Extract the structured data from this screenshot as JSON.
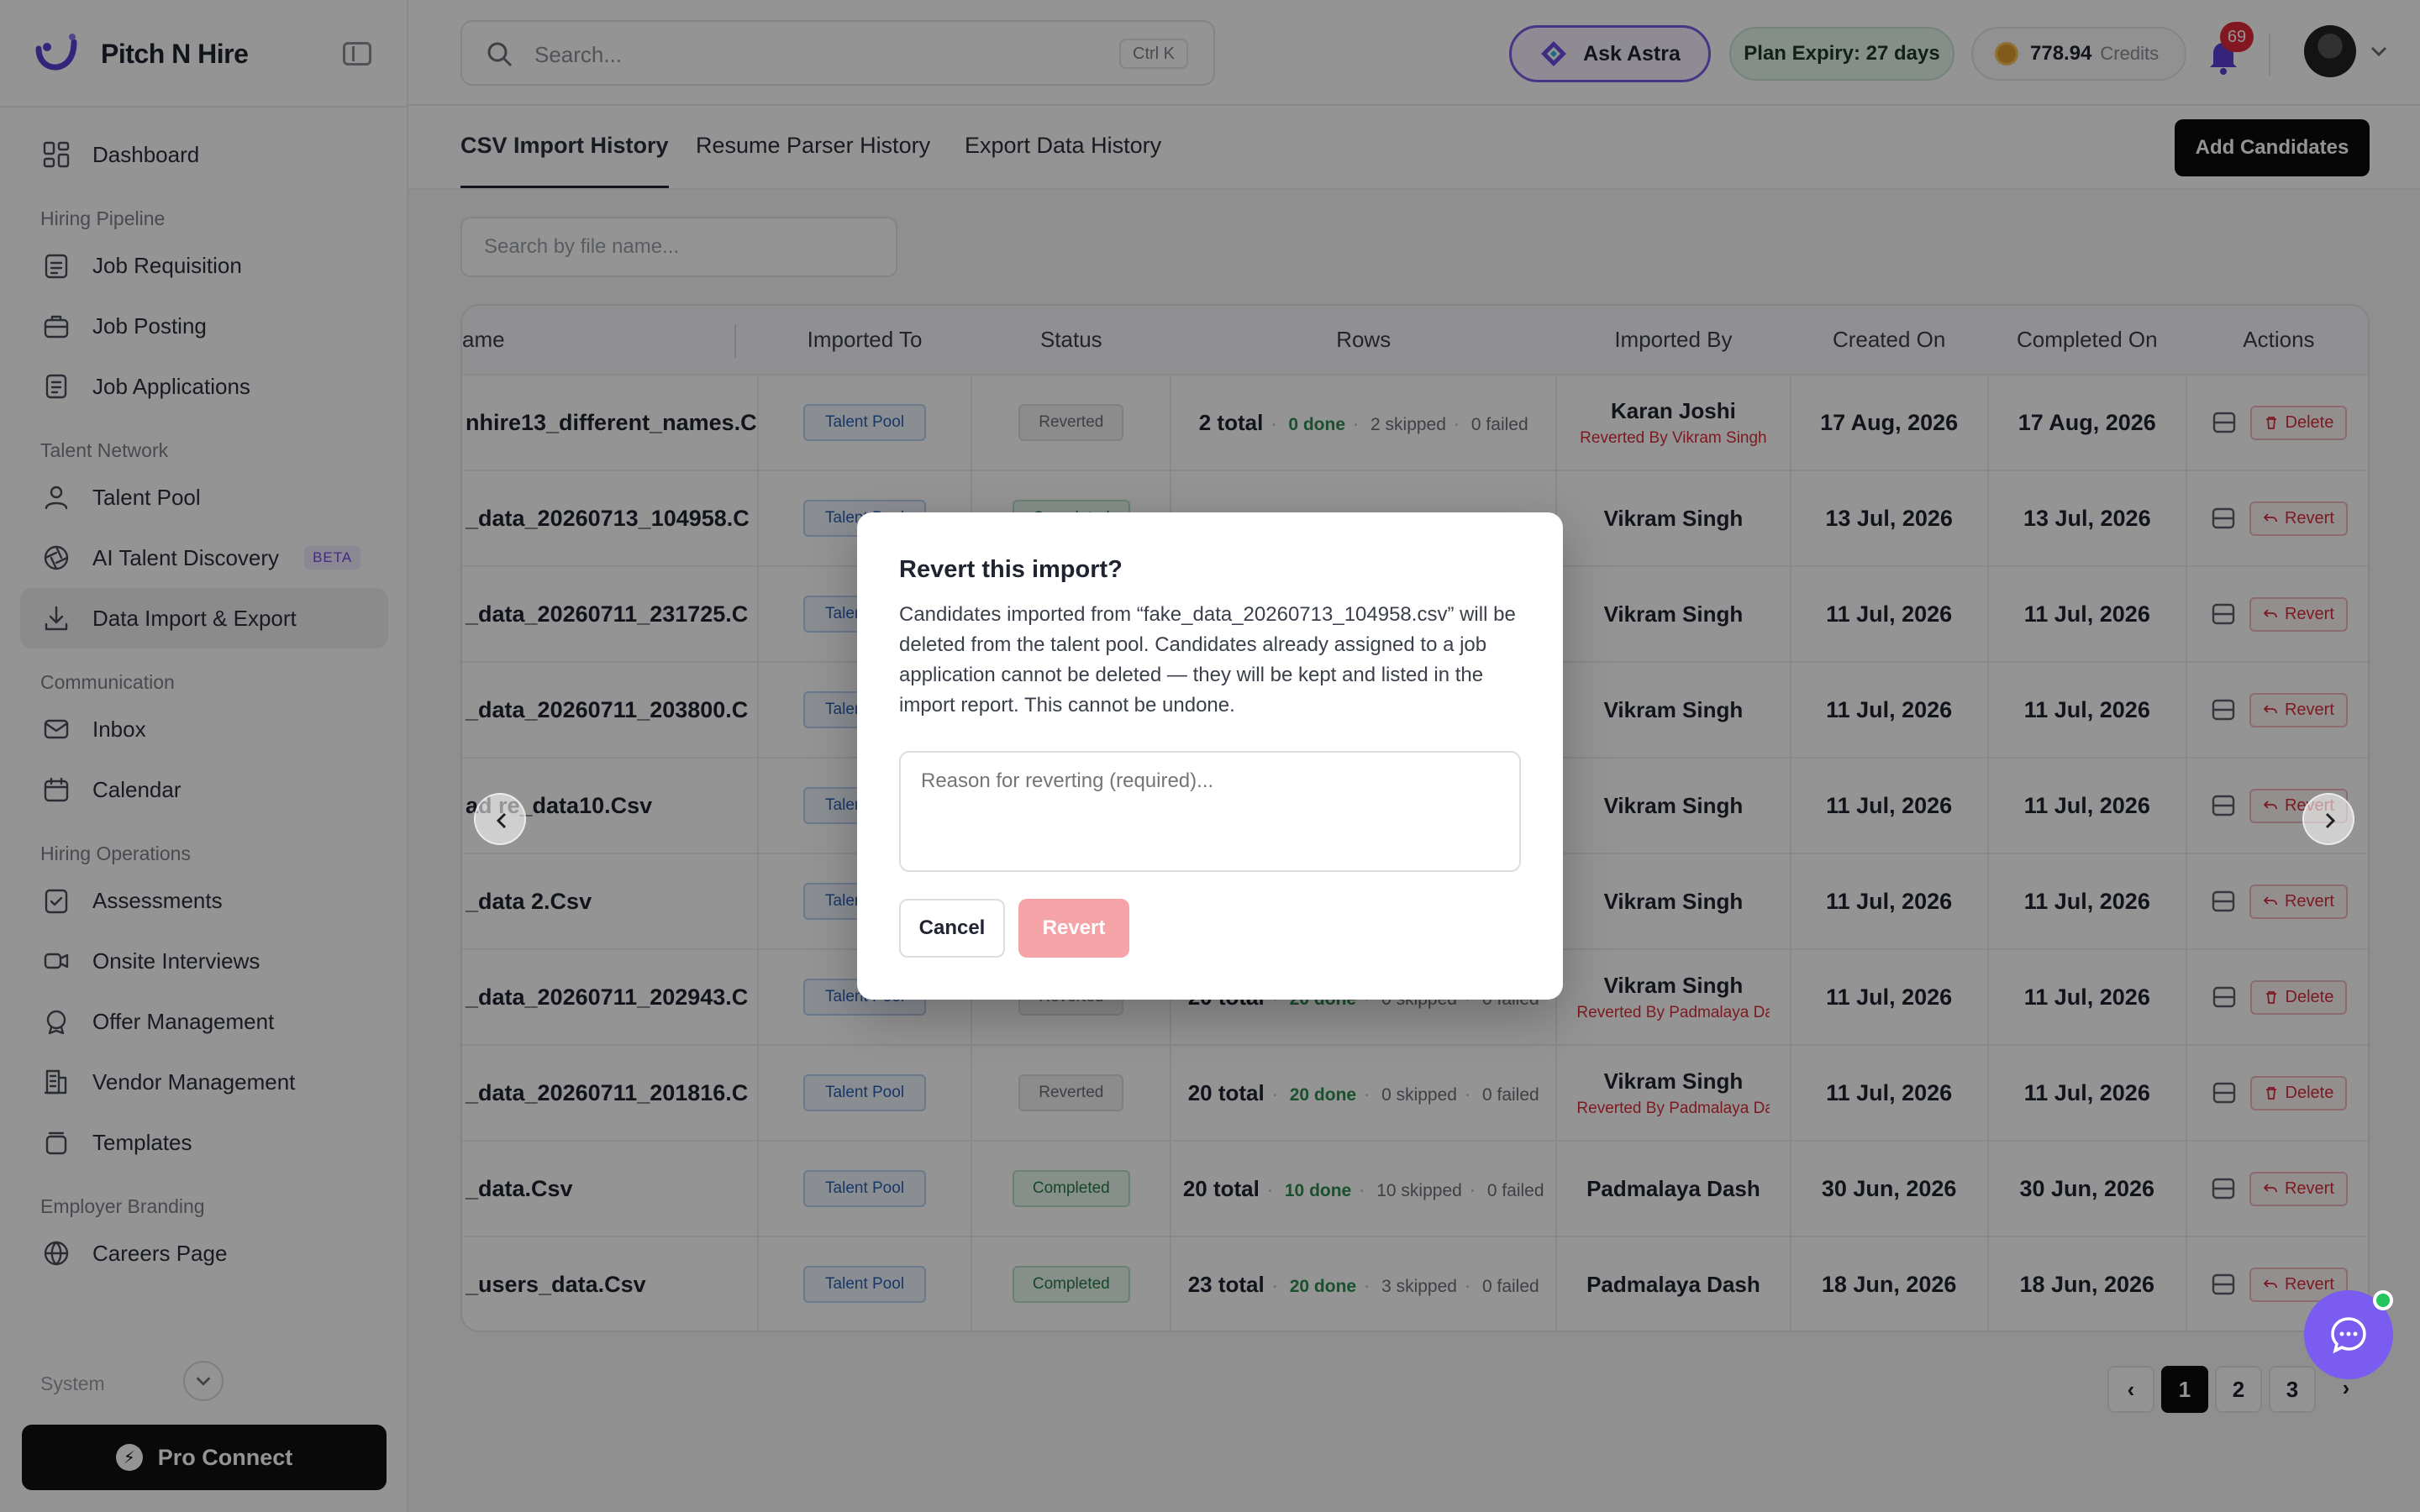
{
  "app": {
    "name": "Pitch N Hire"
  },
  "sidebar": {
    "sections": [
      {
        "label": "",
        "items": [
          {
            "label": "Dashboard",
            "icon": "grid-icon"
          }
        ]
      },
      {
        "label": "Hiring Pipeline",
        "items": [
          {
            "label": "Job Requisition",
            "icon": "clipboard-icon"
          },
          {
            "label": "Job Posting",
            "icon": "briefcase-icon"
          },
          {
            "label": "Job Applications",
            "icon": "document-icon"
          }
        ]
      },
      {
        "label": "Talent Network",
        "items": [
          {
            "label": "Talent Pool",
            "icon": "users-icon"
          },
          {
            "label": "AI Talent Discovery",
            "icon": "aperture-icon",
            "badge": "BETA"
          },
          {
            "label": "Data Import & Export",
            "icon": "download-icon",
            "active": true
          }
        ]
      },
      {
        "label": "Communication",
        "items": [
          {
            "label": "Inbox",
            "icon": "mail-icon"
          },
          {
            "label": "Calendar",
            "icon": "calendar-icon"
          }
        ]
      },
      {
        "label": "Hiring Operations",
        "items": [
          {
            "label": "Assessments",
            "icon": "clipboard-check-icon"
          },
          {
            "label": "Onsite Interviews",
            "icon": "video-icon"
          },
          {
            "label": "Offer Management",
            "icon": "badge-icon"
          },
          {
            "label": "Vendor Management",
            "icon": "building-icon"
          },
          {
            "label": "Templates",
            "icon": "stack-icon"
          }
        ]
      },
      {
        "label": "Employer Branding",
        "items": [
          {
            "label": "Careers Page",
            "icon": "globe-icon"
          }
        ]
      }
    ],
    "system_label": "System",
    "pro_connect": "Pro Connect"
  },
  "topbar": {
    "search_placeholder": "Search...",
    "search_shortcut": "Ctrl K",
    "ask_astra": "Ask Astra",
    "plan_expiry": "Plan Expiry: 27 days",
    "credits_value": "778.94",
    "credits_label": "Credits",
    "notifications": "69"
  },
  "tabs": [
    {
      "label": "CSV Import History",
      "active": true
    },
    {
      "label": "Resume Parser History"
    },
    {
      "label": "Export Data History"
    }
  ],
  "add_candidates": "Add Candidates",
  "file_search_placeholder": "Search by file name...",
  "table": {
    "columns": [
      "ame",
      "Imported To",
      "Status",
      "Rows",
      "Imported By",
      "Created On",
      "Completed On",
      "Actions"
    ],
    "rows": [
      {
        "file": "nhire13_different_names.C",
        "to": "Talent Pool",
        "status": "Reverted",
        "total": "2 total",
        "done": "0 done",
        "skipped": "2 skipped",
        "failed": "0 failed",
        "by": "Karan Joshi",
        "reverted_by": "Reverted By Vikram Singh",
        "created": "17 Aug, 2026",
        "completed": "17 Aug, 2026",
        "action": "Delete"
      },
      {
        "file": "_data_20260713_104958.C",
        "to": "Talent Pool",
        "status": "Completed",
        "total": "",
        "done": "",
        "skipped": "",
        "failed": "",
        "by": "Vikram Singh",
        "reverted_by": "",
        "created": "13 Jul, 2026",
        "completed": "13 Jul, 2026",
        "action": "Revert"
      },
      {
        "file": "_data_20260711_231725.C",
        "to": "Talent Pool",
        "status": "",
        "total": "",
        "done": "",
        "skipped": "",
        "failed": "",
        "by": "Vikram Singh",
        "reverted_by": "",
        "created": "11 Jul, 2026",
        "completed": "11 Jul, 2026",
        "action": "Revert"
      },
      {
        "file": "_data_20260711_203800.C",
        "to": "Talent Pool",
        "status": "",
        "total": "",
        "done": "",
        "skipped": "",
        "failed": "",
        "by": "Vikram Singh",
        "reverted_by": "",
        "created": "11 Jul, 2026",
        "completed": "11 Jul, 2026",
        "action": "Revert"
      },
      {
        "file": "ad  re_data10.Csv",
        "to": "Talent Pool",
        "status": "",
        "total": "",
        "done": "",
        "skipped": "",
        "failed": "",
        "by": "Vikram Singh",
        "reverted_by": "",
        "created": "11 Jul, 2026",
        "completed": "11 Jul, 2026",
        "action": "Revert"
      },
      {
        "file": "_data 2.Csv",
        "to": "Talent Pool",
        "status": "",
        "total": "",
        "done": "",
        "skipped": "",
        "failed": "",
        "by": "Vikram Singh",
        "reverted_by": "",
        "created": "11 Jul, 2026",
        "completed": "11 Jul, 2026",
        "action": "Revert"
      },
      {
        "file": "_data_20260711_202943.C",
        "to": "Talent Pool",
        "status": "Reverted",
        "total": "20 total",
        "done": "20 done",
        "skipped": "0 skipped",
        "failed": "0 failed",
        "by": "Vikram Singh",
        "reverted_by": "Reverted By Padmalaya Dash",
        "created": "11 Jul, 2026",
        "completed": "11 Jul, 2026",
        "action": "Delete"
      },
      {
        "file": "_data_20260711_201816.C",
        "to": "Talent Pool",
        "status": "Reverted",
        "total": "20 total",
        "done": "20 done",
        "skipped": "0 skipped",
        "failed": "0 failed",
        "by": "Vikram Singh",
        "reverted_by": "Reverted By Padmalaya Dash",
        "created": "11 Jul, 2026",
        "completed": "11 Jul, 2026",
        "action": "Delete"
      },
      {
        "file": "_data.Csv",
        "to": "Talent Pool",
        "status": "Completed",
        "total": "20 total",
        "done": "10 done",
        "skipped": "10 skipped",
        "failed": "0 failed",
        "by": "Padmalaya Dash",
        "reverted_by": "",
        "created": "30 Jun, 2026",
        "completed": "30 Jun, 2026",
        "action": "Revert"
      },
      {
        "file": "_users_data.Csv",
        "to": "Talent Pool",
        "status": "Completed",
        "total": "23 total",
        "done": "20 done",
        "skipped": "3 skipped",
        "failed": "0 failed",
        "by": "Padmalaya Dash",
        "reverted_by": "",
        "created": "18 Jun, 2026",
        "completed": "18 Jun, 2026",
        "action": "Revert"
      }
    ]
  },
  "pagination": [
    "1",
    "2",
    "3"
  ],
  "modal": {
    "title": "Revert this import?",
    "message": "Candidates imported from “fake_data_20260713_104958.csv” will be deleted from the talent pool. Candidates already assigned to a job application cannot be deleted — they will be kept and listed in the import report. This cannot be undone.",
    "reason_placeholder": "Reason for reverting (required)...",
    "cancel": "Cancel",
    "revert": "Revert"
  },
  "colors": {
    "accent": "#7a5cf0",
    "danger": "#d62e3a",
    "success": "#2d8a4e"
  }
}
